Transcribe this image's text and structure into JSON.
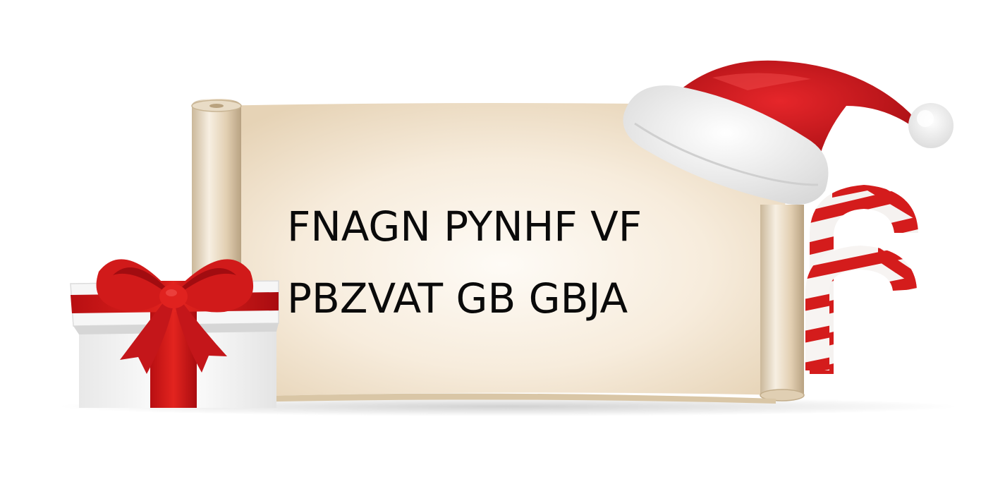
{
  "message": {
    "line1": "FNAGN PYNHF VF",
    "line2": "PBZVAT GB GBJA"
  },
  "colors": {
    "background": "#ffffff",
    "parchment": "#efe3cf",
    "parchment_center": "#fdf9f2",
    "ribbon_red": "#d11a1a",
    "hat_red": "#c8161b",
    "fur_white": "#f4f4f4",
    "text": "#0a0a0a"
  },
  "icons": [
    "gift-box-icon",
    "santa-hat-icon",
    "candy-cane-icon",
    "scroll-icon"
  ]
}
